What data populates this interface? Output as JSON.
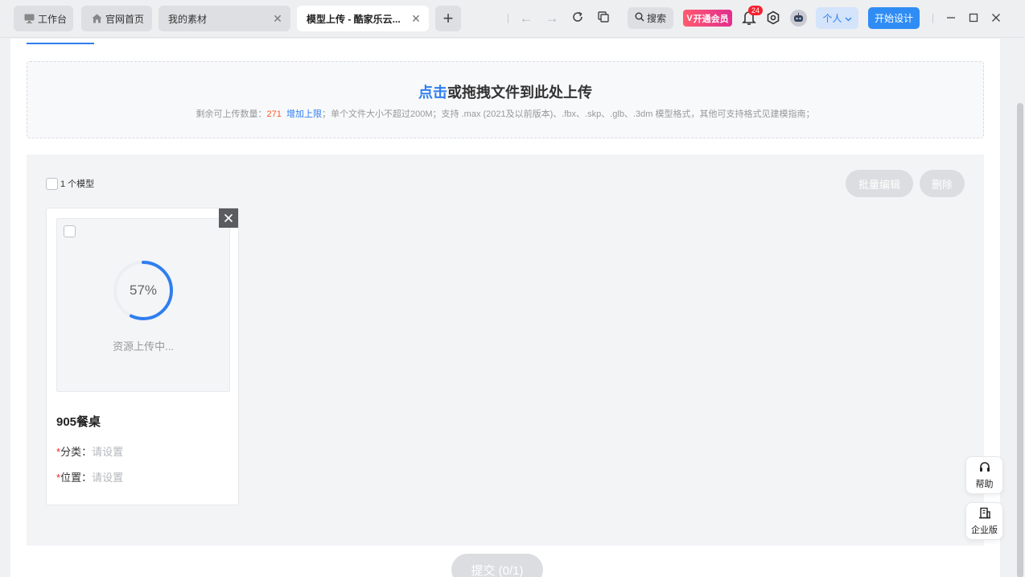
{
  "tabs": [
    {
      "label": "工作台",
      "icon": "monitor-icon"
    },
    {
      "label": "官网首页",
      "icon": "home-icon"
    },
    {
      "label": "我的素材",
      "closable": true
    },
    {
      "label": "模型上传 - 酷家乐云...",
      "closable": true,
      "active": true
    }
  ],
  "toolbar": {
    "search_label": "搜索",
    "vip_label": "开通会员",
    "notification_count": "24",
    "personal_label": "个人",
    "start_design_label": "开始设计"
  },
  "upload": {
    "title_click": "点击",
    "title_rest": "或拖拽文件到此处上传",
    "note_prefix": "剩余可上传数量：",
    "remaining_count": "271",
    "increase_limit": "增加上限",
    "note_rest": "；单个文件大小不超过200M；支持 .max (2021及以前版本)、.fbx、.skp、.glb、.3dm 模型格式，其他可支持格式见建模指南；"
  },
  "list": {
    "select_all_label": "1 个模型",
    "batch_edit_label": "批量编辑",
    "delete_label": "删除"
  },
  "card": {
    "progress": 57,
    "progress_text": "57%",
    "status": "资源上传中...",
    "name": "905餐桌",
    "category_label": "分类：",
    "category_value": "请设置",
    "position_label": "位置：",
    "position_value": "请设置",
    "required_mark": "*"
  },
  "submit_label": "提交 (0/1)",
  "float": {
    "help_label": "帮助",
    "enterprise_label": "企业版"
  },
  "colors": {
    "accent": "#2f7ef0",
    "progress_ring": "#2f7ef0",
    "badge": "#f5222d",
    "count": "#ff5722"
  }
}
